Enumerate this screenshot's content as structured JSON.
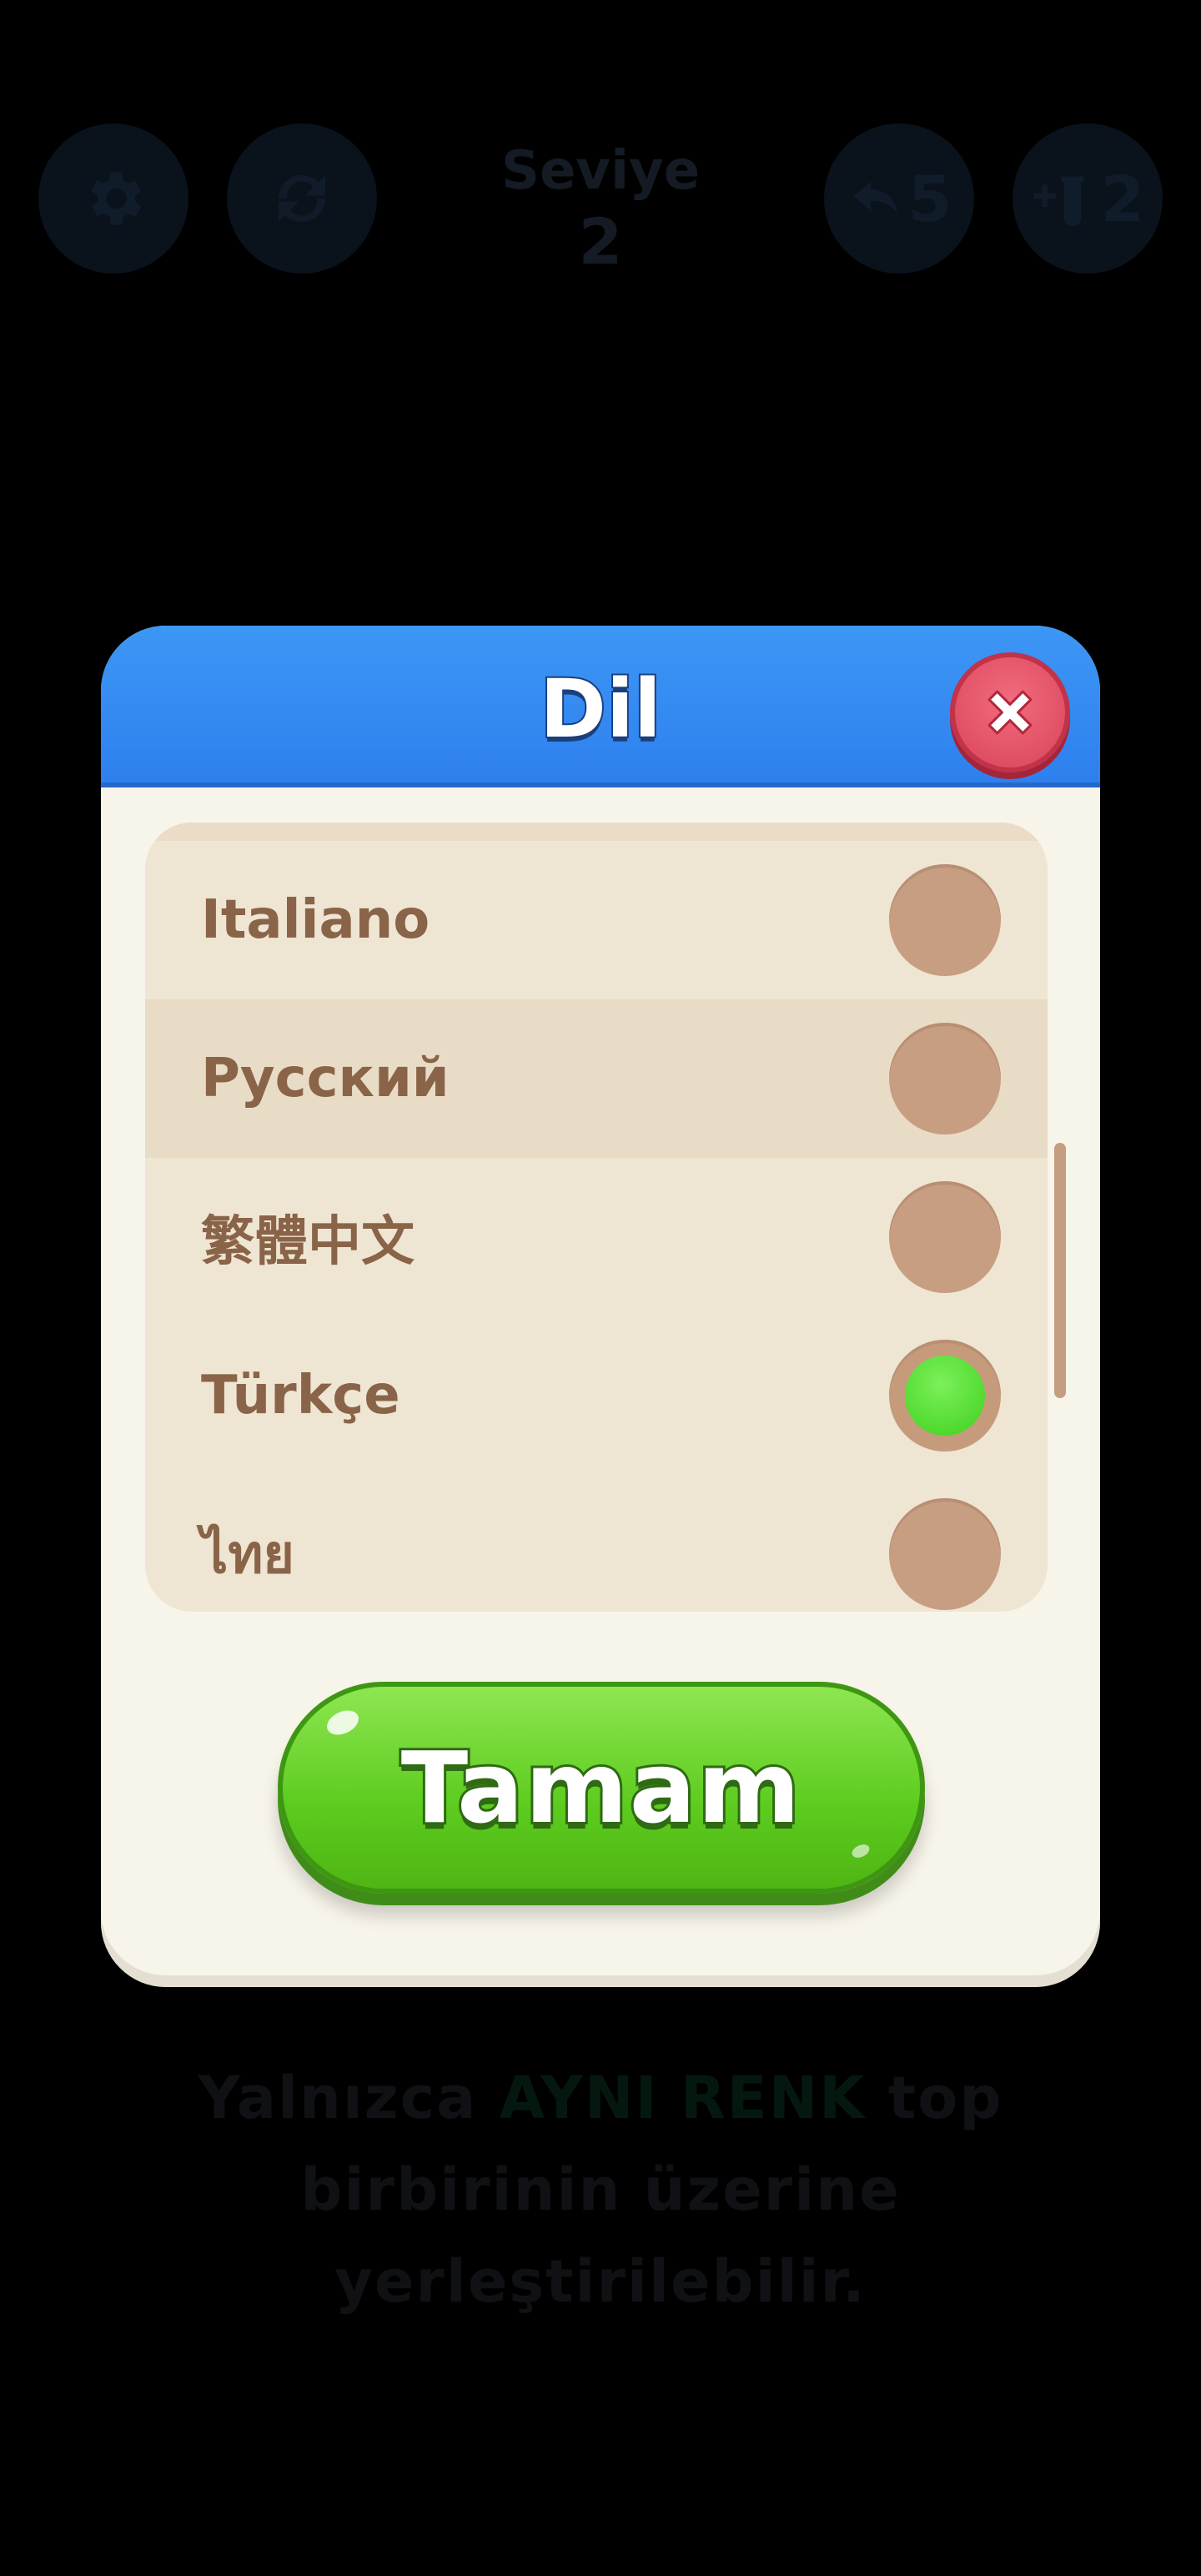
{
  "background": {
    "level_label": "Seviye",
    "level_number": "2",
    "undo_count": "5",
    "extra_tube_count": "2",
    "hint_prefix": "Yalnızca ",
    "hint_highlight": "AYNI RENK",
    "hint_suffix_1": " top",
    "hint_line_2": "birbirinin üzerine",
    "hint_line_3": "yerleştirilebilir."
  },
  "dialog": {
    "title": "Dil",
    "languages": [
      {
        "label": "Italiano",
        "selected": false
      },
      {
        "label": "Русский",
        "selected": false
      },
      {
        "label": "繁體中文",
        "selected": false
      },
      {
        "label": "Türkçe",
        "selected": true
      },
      {
        "label": "ไทย",
        "selected": false
      }
    ],
    "confirm_label": "Tamam"
  },
  "colors": {
    "header_blue": "#2e80ee",
    "close_red": "#e0526a",
    "confirm_green": "#5ccb1e",
    "selected_dot": "#3fd11d",
    "label_brown": "#8a6448"
  }
}
